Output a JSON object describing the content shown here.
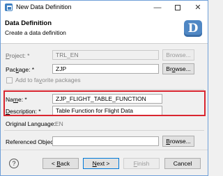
{
  "window": {
    "title": "New Data Definition",
    "controls": {
      "minimize": "—",
      "close": "✕"
    }
  },
  "header": {
    "title": "Data Definition",
    "subtitle": "Create a data definition",
    "banner_letter": "D"
  },
  "form": {
    "project": {
      "label_pre": "",
      "label_key": "P",
      "label_post": "roject: *",
      "value": "TRL_EN",
      "browse": "Browse..."
    },
    "package": {
      "label_pre": "Pac",
      "label_key": "k",
      "label_post": "age: *",
      "value": "ZJP",
      "browse_pre": "Br",
      "browse_key": "o",
      "browse_post": "wse..."
    },
    "favorite": {
      "label_pre": "Add to fa",
      "label_key": "v",
      "label_post": "orite packages"
    },
    "name": {
      "label_pre": "Na",
      "label_key": "m",
      "label_post": "e: *",
      "value": "ZJP_FLIGHT_TABLE_FUNCTION"
    },
    "description": {
      "label_pre": "",
      "label_key": "D",
      "label_post": "escription: *",
      "value": "Table Function for Flight Data"
    },
    "original_language": {
      "label": "Original Language:",
      "value": "EN"
    },
    "referenced_object": {
      "label": "Referenced Object:",
      "value": "",
      "browse_pre": "",
      "browse_key": "B",
      "browse_post": "rowse..."
    }
  },
  "footer": {
    "help": "?",
    "back": {
      "pre": "< ",
      "key": "B",
      "post": "ack"
    },
    "next": {
      "pre": "",
      "key": "N",
      "post": "ext >"
    },
    "finish": {
      "pre": "",
      "key": "F",
      "post": "inish"
    },
    "cancel": "Cancel"
  },
  "colors": {
    "highlight": "#d9252f",
    "banner": "#4f87c4",
    "window_border": "#6f9fd8"
  }
}
